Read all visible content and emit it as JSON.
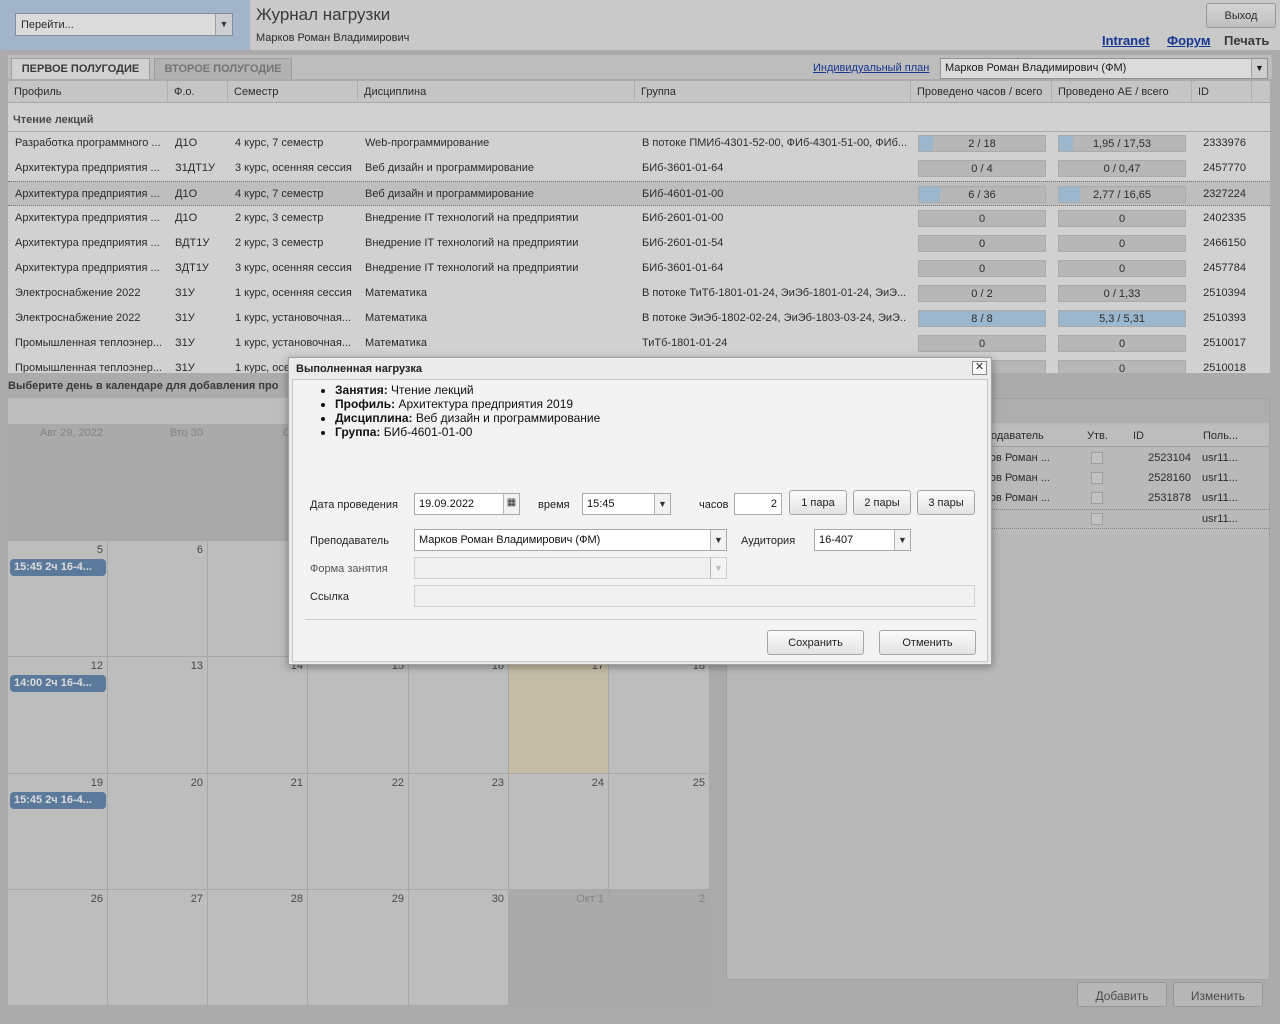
{
  "header": {
    "goto_placeholder": "Перейти...",
    "title": "Журнал нагрузки",
    "user": "Марков Роман Владимирович",
    "logout": "Выход",
    "links": [
      "Intranet",
      "Форум",
      "Печать"
    ]
  },
  "tabs": [
    "ПЕРВОЕ ПОЛУГОДИЕ",
    "ВТОРОЕ ПОЛУГОДИЕ"
  ],
  "individual_plan": "Индивидуальный план",
  "teacher_select": "Марков Роман Владимирович (ФМ)",
  "grid": {
    "columns": [
      "Профиль",
      "Ф.о.",
      "Семестр",
      "Дисциплина",
      "Группа",
      "Проведено часов / всего",
      "Проведено АЕ / всего",
      "ID"
    ],
    "group_title": "Чтение лекций",
    "rows": [
      {
        "profile": "Разработка программного ...",
        "fo": "Д1О",
        "sem": "4 курс, 7 семестр",
        "disc": "Web-программирование",
        "group": "В потоке ПМИб-4301-52-00, ФИб-4301-51-00, ФИб...",
        "hours": "2 / 18",
        "hours_frac": 0.11,
        "ae": "1,95 / 17,53",
        "ae_frac": 0.11,
        "id": "2333976"
      },
      {
        "profile": "Архитектура предприятия ...",
        "fo": "З1ДТ1У",
        "sem": "3 курс, осенняя сессия",
        "disc": "Веб дизайн и программирование",
        "group": "БИб-3601-01-64",
        "hours": "0 / 4",
        "hours_frac": 0,
        "ae": "0 / 0,47",
        "ae_frac": 0,
        "id": "2457770"
      },
      {
        "profile": "Архитектура предприятия ...",
        "fo": "Д1О",
        "sem": "4 курс, 7 семестр",
        "disc": "Веб дизайн и программирование",
        "group": "БИб-4601-01-00",
        "hours": "6 / 36",
        "hours_frac": 0.17,
        "ae": "2,77 / 16,65",
        "ae_frac": 0.17,
        "id": "2327224"
      },
      {
        "profile": "Архитектура предприятия ...",
        "fo": "Д1О",
        "sem": "2 курс, 3 семестр",
        "disc": "Внедрение IT технологий на предприятии",
        "group": "БИб-2601-01-00",
        "hours": "0",
        "hours_frac": 0,
        "ae": "0",
        "ae_frac": 0,
        "id": "2402335"
      },
      {
        "profile": "Архитектура предприятия ...",
        "fo": "ВДТ1У",
        "sem": "2 курс, 3 семестр",
        "disc": "Внедрение IT технологий на предприятии",
        "group": "БИб-2601-01-54",
        "hours": "0",
        "hours_frac": 0,
        "ae": "0",
        "ae_frac": 0,
        "id": "2466150"
      },
      {
        "profile": "Архитектура предприятия ...",
        "fo": "ЗДТ1У",
        "sem": "3 курс, осенняя сессия",
        "disc": "Внедрение IT технологий на предприятии",
        "group": "БИб-3601-01-64",
        "hours": "0",
        "hours_frac": 0,
        "ae": "0",
        "ae_frac": 0,
        "id": "2457784"
      },
      {
        "profile": "Электроснабжение 2022",
        "fo": "З1У",
        "sem": "1 курс, осенняя сессия",
        "disc": "Математика",
        "group": "В потоке ТиТб-1801-01-24, ЭиЭб-1801-01-24, ЭиЭ...",
        "hours": "0 / 2",
        "hours_frac": 0,
        "ae": "0 / 1,33",
        "ae_frac": 0,
        "id": "2510394"
      },
      {
        "profile": "Электроснабжение 2022",
        "fo": "З1У",
        "sem": "1 курс, установочная...",
        "disc": "Математика",
        "group": "В потоке ЭиЭб-1802-02-24, ЭиЭб-1803-03-24, ЭиЭ...",
        "hours": "8 / 8",
        "hours_frac": 1,
        "ae": "5,3 / 5,31",
        "ae_frac": 1,
        "id": "2510393"
      },
      {
        "profile": "Промышленная теплоэнер...",
        "fo": "З1У",
        "sem": "1 курс, установочная...",
        "disc": "Математика",
        "group": "ТиТб-1801-01-24",
        "hours": "0",
        "hours_frac": 0,
        "ae": "0",
        "ae_frac": 0,
        "id": "2510017"
      },
      {
        "profile": "Промышленная теплоэнер...",
        "fo": "З1У",
        "sem": "1 курс, осе",
        "disc": "",
        "group": "",
        "hours": "0",
        "hours_frac": 0,
        "ae": "0",
        "ae_frac": 0,
        "id": "2510018"
      }
    ]
  },
  "calendar": {
    "caption": "Выберите день в календаре для добавления про",
    "weeks": [
      [
        {
          "n": "Авг 29, 2022",
          "o": true
        },
        {
          "n": "Вто 30",
          "o": true
        },
        {
          "n": "Сре",
          "o": true
        },
        {
          "n": "",
          "o": false
        },
        {
          "n": "",
          "o": false
        },
        {
          "n": "",
          "o": false
        },
        {
          "n": "",
          "o": false
        }
      ],
      [
        {
          "n": "5",
          "e": "15:45 2ч 16-4..."
        },
        {
          "n": "6"
        },
        {
          "n": ""
        },
        {
          "n": ""
        },
        {
          "n": ""
        },
        {
          "n": ""
        },
        {
          "n": ""
        }
      ],
      [
        {
          "n": "12",
          "e": "14:00 2ч 16-4..."
        },
        {
          "n": "13"
        },
        {
          "n": "14"
        },
        {
          "n": "15"
        },
        {
          "n": "16"
        },
        {
          "n": "17",
          "t": true
        },
        {
          "n": "18"
        }
      ],
      [
        {
          "n": "19",
          "e": "15:45 2ч 16-4..."
        },
        {
          "n": "20"
        },
        {
          "n": "21"
        },
        {
          "n": "22"
        },
        {
          "n": "23"
        },
        {
          "n": "24"
        },
        {
          "n": "25"
        }
      ],
      [
        {
          "n": "26"
        },
        {
          "n": "27"
        },
        {
          "n": "28"
        },
        {
          "n": "29"
        },
        {
          "n": "30"
        },
        {
          "n": "Окт 1",
          "o": true
        },
        {
          "n": "2",
          "o": true
        }
      ]
    ]
  },
  "right_panel": {
    "columns": [
      "подаватель",
      "Утв.",
      "ID",
      "Поль..."
    ],
    "rows": [
      {
        "teacher": "ков Роман ...",
        "id": "2523104",
        "user": "usr11..."
      },
      {
        "teacher": "ков Роман ...",
        "id": "2528160",
        "user": "usr11..."
      },
      {
        "teacher": "ков Роман ...",
        "id": "2531878",
        "user": "usr11..."
      },
      {
        "teacher": "",
        "id": "",
        "user": "usr11..."
      }
    ],
    "add": "Добавить",
    "edit": "Изменить"
  },
  "modal": {
    "title": "Выполненная нагрузка",
    "info": [
      {
        "k": "Занятия:",
        "v": "Чтение лекций"
      },
      {
        "k": "Профиль:",
        "v": "Архитектура предприятия 2019"
      },
      {
        "k": "Дисциплина:",
        "v": "Веб дизайн и программирование"
      },
      {
        "k": "Группа:",
        "v": "БИб-4601-01-00"
      }
    ],
    "date_label": "Дата проведения",
    "date": "19.09.2022",
    "time_label": "время",
    "time": "15:45",
    "hours_label": "часов",
    "hours": "2",
    "pair1": "1 пара",
    "pair2": "2 пары",
    "pair3": "3 пары",
    "teacher_label": "Преподаватель",
    "teacher": "Марков Роман Владимирович (ФМ)",
    "room_label": "Аудитория",
    "room": "16-407",
    "form_label": "Форма занятия",
    "link_label": "Ссылка",
    "save": "Сохранить",
    "cancel": "Отменить"
  }
}
